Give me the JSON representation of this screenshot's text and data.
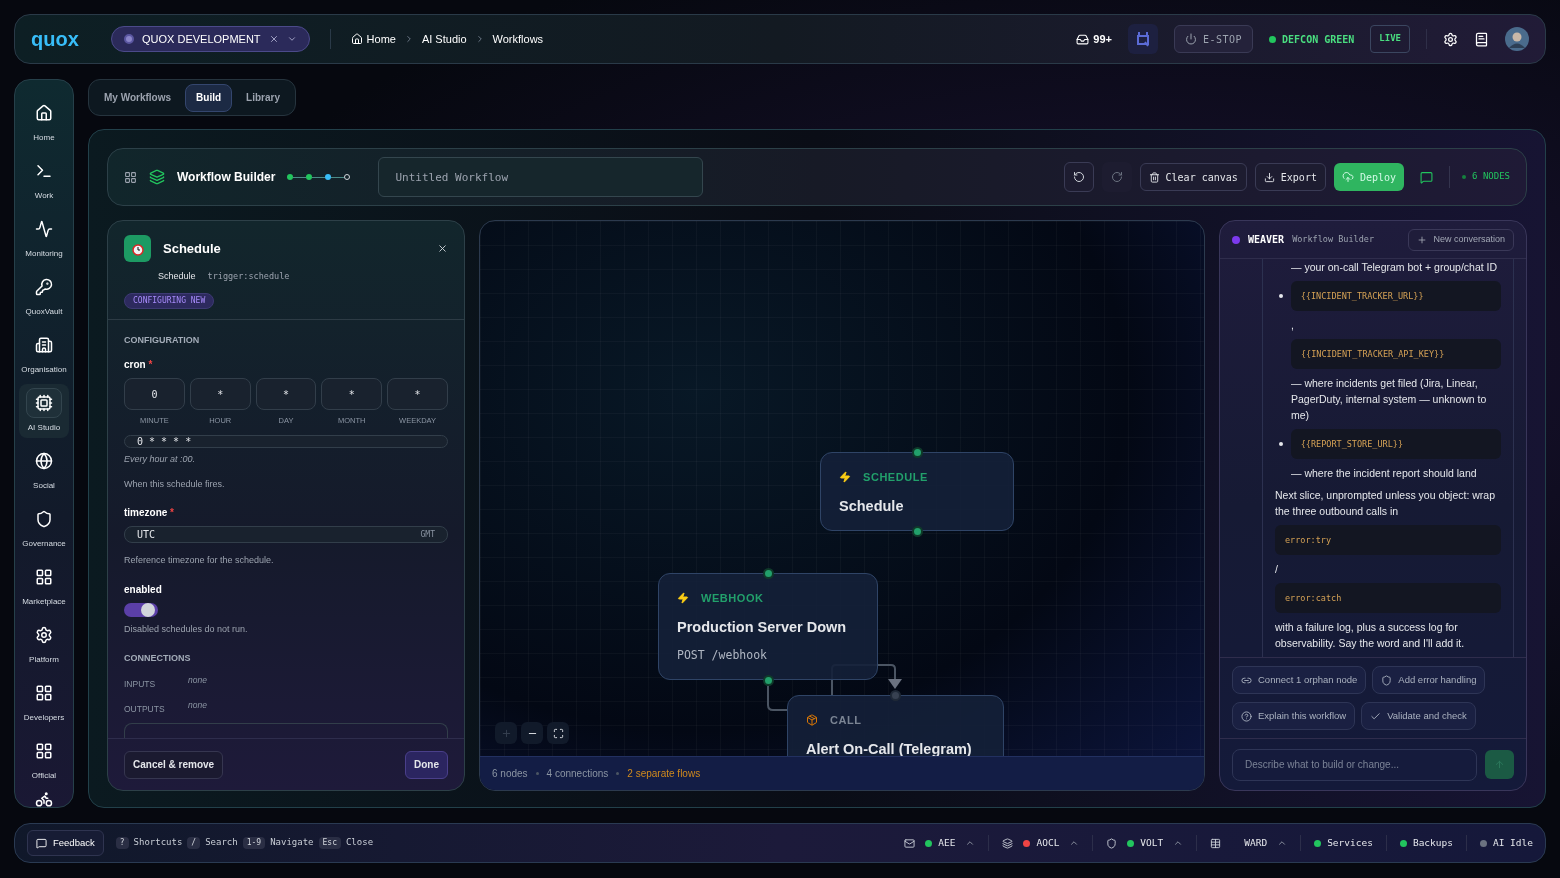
{
  "top_bar": {
    "logo": "quox",
    "workspace": "QUOX DEVELOPMENT",
    "breadcrumbs": [
      "Home",
      "AI Studio",
      "Workflows"
    ],
    "inbox_count": "99+",
    "estop": "E-STOP",
    "defcon": "DEFCON GREEN",
    "live": "LIVE"
  },
  "sidebar": {
    "items": [
      {
        "label": "Home",
        "selected": false
      },
      {
        "label": "Work",
        "selected": false
      },
      {
        "label": "Monitoring",
        "selected": false
      },
      {
        "label": "QuoxVault",
        "selected": false
      },
      {
        "label": "Organisation",
        "selected": false
      },
      {
        "label": "AI Studio",
        "selected": true
      },
      {
        "label": "Social",
        "selected": false
      },
      {
        "label": "Governance",
        "selected": false
      },
      {
        "label": "Marketplace",
        "selected": false
      },
      {
        "label": "Platform",
        "selected": false
      },
      {
        "label": "Developers",
        "selected": false
      },
      {
        "label": "Official",
        "selected": false
      }
    ]
  },
  "tabs": [
    {
      "label": "My Workflows",
      "selected": false
    },
    {
      "label": "Build",
      "selected": true
    },
    {
      "label": "Library",
      "selected": false
    }
  ],
  "builder": {
    "title": "Workflow Builder",
    "steps": [
      {
        "kind": "done"
      },
      {
        "kind": "done"
      },
      {
        "kind": "current"
      },
      {
        "kind": "pending"
      }
    ],
    "name_field": {
      "placeholder": "Untitled Workflow"
    },
    "clear": "Clear canvas",
    "export": "Export",
    "deploy": "Deploy",
    "node_count": "6 NODES"
  },
  "config_panel": {
    "title": "Schedule",
    "subtitle": "Schedule",
    "type": "trigger:schedule",
    "badge": "CONFIGURING NEW",
    "section": "CONFIGURATION",
    "cron": {
      "label": "cron",
      "required": true,
      "fields": [
        {
          "value": "0",
          "label": "MINUTE"
        },
        {
          "value": "*",
          "label": "HOUR"
        },
        {
          "value": "*",
          "label": "DAY"
        },
        {
          "value": "*",
          "label": "MONTH"
        },
        {
          "value": "*",
          "label": "WEEKDAY"
        }
      ],
      "expression": "0 * * * *",
      "summary": "Every hour at :00.",
      "help": "When this schedule fires."
    },
    "timezone": {
      "label": "timezone",
      "required": true,
      "value": "UTC",
      "suffix": "GMT",
      "help": "Reference timezone for the schedule."
    },
    "enabled": {
      "label": "enabled",
      "on": true,
      "help": "Disabled schedules do not run."
    },
    "connections": {
      "title": "CONNECTIONS",
      "inputs": {
        "label": "INPUTS",
        "value": "none"
      },
      "outputs": {
        "label": "OUTPUTS",
        "value": "none"
      }
    },
    "cancel": "Cancel & remove",
    "done": "Done"
  },
  "canvas": {
    "nodes": [
      {
        "kind": "trigger",
        "tag": "SCHEDULE",
        "title": "Schedule"
      },
      {
        "kind": "trigger",
        "tag": "WEBHOOK",
        "title": "Production Server Down",
        "detail": "POST /webhook"
      },
      {
        "kind": "call",
        "tag": "CALL",
        "title": "Alert On-Call (Telegram)"
      }
    ],
    "stats": {
      "nodes": "6 nodes",
      "connections": "4 connections",
      "flows": "2 separate flows"
    }
  },
  "assistant": {
    "name": "WEAVER",
    "context": "Workflow Builder",
    "new_button": "New conversation",
    "messages": [
      {
        "kind": "item_text",
        "text": "— your on-call Telegram bot + group/chat ID"
      },
      {
        "kind": "bullet_code",
        "text": "{{INCIDENT_TRACKER_URL}}"
      },
      {
        "kind": "item_text",
        "text": ","
      },
      {
        "kind": "item_code",
        "text": "{{INCIDENT_TRACKER_API_KEY}}"
      },
      {
        "kind": "item_text",
        "text": "— where incidents get filed (Jira, Linear, PagerDuty, internal system — unknown to me)"
      },
      {
        "kind": "bullet_code",
        "text": "{{REPORT_STORE_URL}}"
      },
      {
        "kind": "item_text",
        "text": "— where the incident report should land"
      },
      {
        "kind": "text",
        "text": "Next slice, unprompted unless you object: wrap the three outbound calls in"
      },
      {
        "kind": "code",
        "text": "error:try"
      },
      {
        "kind": "text",
        "text": "/"
      },
      {
        "kind": "code",
        "text": "error:catch"
      },
      {
        "kind": "text",
        "text": "with a failure log, plus a success log for observability. Say the word and I'll add it."
      }
    ],
    "suggestions": [
      "Connect 1 orphan node",
      "Add error handling",
      "Explain this workflow",
      "Validate and check"
    ],
    "input": {
      "placeholder": "Describe what to build or change..."
    }
  },
  "status_bar": {
    "feedback": "Feedback",
    "shortcuts": [
      {
        "key": "?",
        "label": "Shortcuts"
      },
      {
        "key": "/",
        "label": "Search"
      },
      {
        "key": "1-9",
        "label": "Navigate"
      },
      {
        "key": "Esc",
        "label": "Close"
      }
    ],
    "services": [
      {
        "label": "AEE",
        "color": "#22c55e",
        "expandable": true
      },
      {
        "label": "AOCL",
        "color": "#ef4444",
        "expandable": true
      },
      {
        "label": "VOLT",
        "color": "#22c55e",
        "expandable": true
      },
      {
        "label": "WARD",
        "expandable": true
      },
      {
        "label": "Services",
        "color": "#22c55e",
        "expandable": false
      },
      {
        "label": "Backups",
        "color": "#22c55e",
        "expandable": false
      },
      {
        "label": "AI Idle",
        "color": "#6b7280",
        "expandable": false
      }
    ]
  }
}
